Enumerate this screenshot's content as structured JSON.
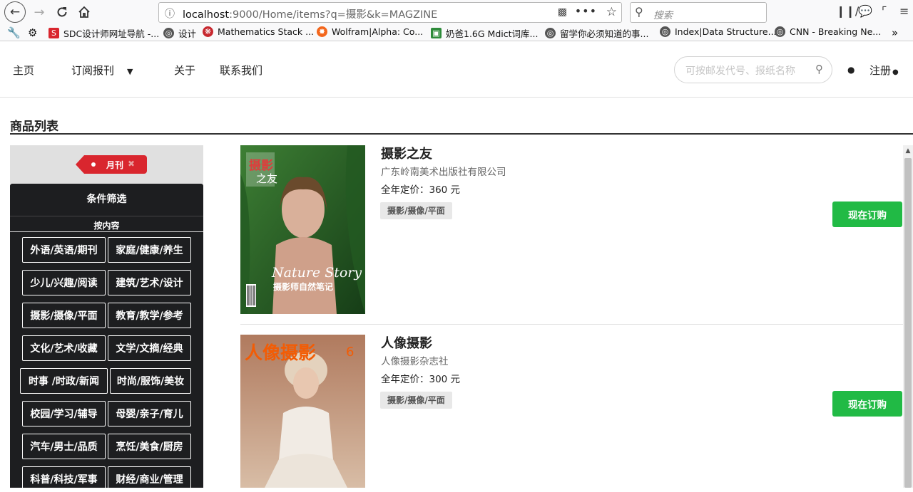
{
  "browser": {
    "url_host": "localhost",
    "url_rest": ":9000/Home/items?q=摄影&k=MAGZINE",
    "search_placeholder": "搜索",
    "bookmarks": [
      {
        "label": "SDC设计师网址导航 -...",
        "icon": "sdc-favicon",
        "color": "#d9262e"
      },
      {
        "label": "设计",
        "icon": "globe-icon",
        "color": "#555555"
      },
      {
        "label": "Mathematics Stack ...",
        "icon": "math-stack-favicon",
        "color": "#c7272e"
      },
      {
        "label": "Wolfram|Alpha: Co...",
        "icon": "wolfram-favicon",
        "color": "#f3661c"
      },
      {
        "label": "奶爸1.6G Mdict词库...",
        "icon": "naiba-favicon",
        "color": "#2e8b3a"
      },
      {
        "label": "留学你必须知道的事...",
        "icon": "globe-icon",
        "color": "#555555"
      },
      {
        "label": "Index|Data Structure...",
        "icon": "globe-icon",
        "color": "#555555"
      },
      {
        "label": "CNN - Breaking Ne...",
        "icon": "globe-icon",
        "color": "#555555"
      }
    ]
  },
  "nav": {
    "home": "主页",
    "subscribe": "订阅报刊",
    "about": "关于",
    "contact": "联系我们",
    "search_placeholder": "可按邮发代号、报纸名称",
    "register": "注册"
  },
  "page": {
    "title": "商品列表"
  },
  "sidebar": {
    "active_tag": "月刊",
    "filter_title": "条件筛选",
    "filter_sub": "按内容",
    "categories": [
      "外语/英语/期刊",
      "家庭/健康/养生",
      "少儿/兴趣/阅读",
      "建筑/艺术/设计",
      "摄影/摄像/平面",
      "教育/教学/参考",
      "文化/艺术/收藏",
      "文学/文摘/经典",
      "时事 /时政/新闻",
      "时尚/服饰/美妆",
      "校园/学习/辅导",
      "母婴/亲子/育儿",
      "汽车/男士/品质",
      "烹饪/美食/厨房",
      "科普/科技/军事",
      "财经/商业/管理"
    ]
  },
  "products": [
    {
      "name": "摄影之友",
      "publisher": "广东岭南美术出版社有限公司",
      "price": "全年定价：360 元",
      "category": "摄影/摄像/平面",
      "button": "现在订购",
      "cover": {
        "logo": "摄影之友",
        "headline": "Nature Story",
        "subheadline": "摄影师自然笔记",
        "bg": "#2d6b2a"
      }
    },
    {
      "name": "人像摄影",
      "publisher": "人像摄影杂志社",
      "price": "全年定价：300 元",
      "category": "摄影/摄像/平面",
      "button": "现在订购",
      "cover": {
        "logo": "人像摄影",
        "issue": "6",
        "bg": "#c9a58a"
      }
    }
  ]
}
